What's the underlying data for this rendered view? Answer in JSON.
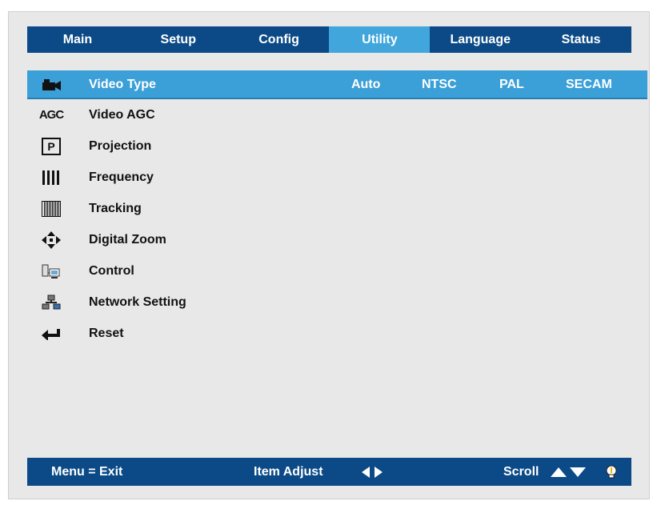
{
  "tabs": [
    {
      "label": "Main"
    },
    {
      "label": "Setup"
    },
    {
      "label": "Config"
    },
    {
      "label": "Utility"
    },
    {
      "label": "Language"
    },
    {
      "label": "Status"
    }
  ],
  "active_tab": "Utility",
  "menu": [
    {
      "label": "Video Type",
      "icon": "camcorder-icon"
    },
    {
      "label": "Video AGC",
      "icon": "agc-icon"
    },
    {
      "label": "Projection",
      "icon": "projection-p-icon"
    },
    {
      "label": "Frequency",
      "icon": "frequency-bars-icon"
    },
    {
      "label": "Tracking",
      "icon": "tracking-bars-icon"
    },
    {
      "label": "Digital Zoom",
      "icon": "four-arrows-icon"
    },
    {
      "label": "Control",
      "icon": "computer-icon"
    },
    {
      "label": "Network Setting",
      "icon": "network-icon"
    },
    {
      "label": "Reset",
      "icon": "return-arrow-icon"
    }
  ],
  "video_type_options": [
    "Auto",
    "NTSC",
    "PAL",
    "SECAM"
  ],
  "agc_icon_text": "AGC",
  "projection_icon_text": "P",
  "footer": {
    "menu_exit": "Menu = Exit",
    "item_adjust": "Item Adjust",
    "scroll": "Scroll"
  },
  "colors": {
    "bar": "#0b4a86",
    "accent": "#41a6dc",
    "selected_row": "#3b9fd8",
    "panel": "#e8e8e8"
  }
}
